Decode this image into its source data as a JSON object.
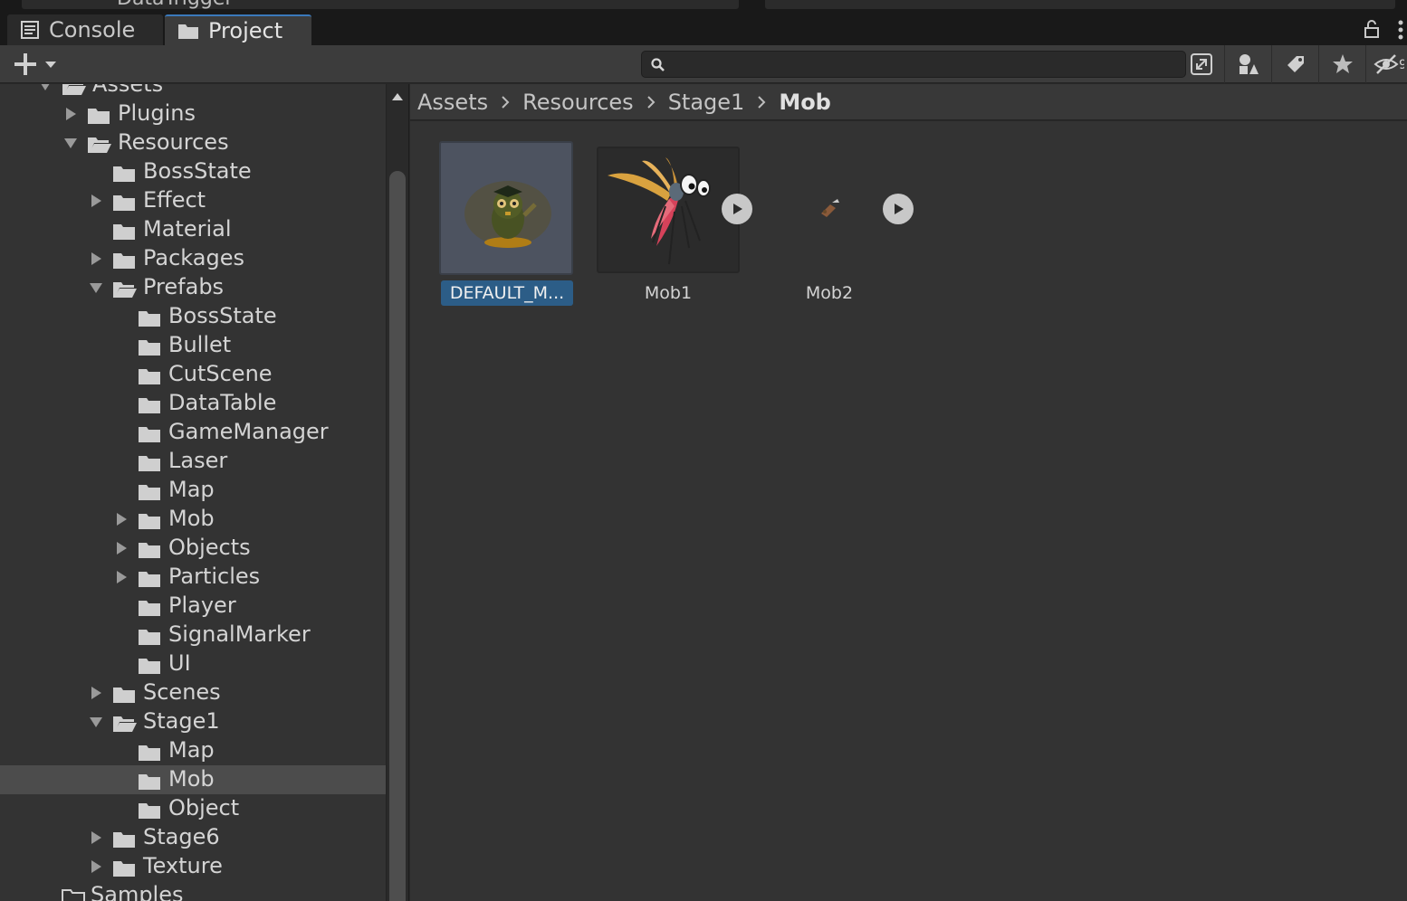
{
  "top_strip": {
    "partial_title": "DataTrigger"
  },
  "tabs": [
    {
      "label": "Console",
      "icon": "console-icon"
    },
    {
      "label": "Project",
      "icon": "folder-icon",
      "active": true
    }
  ],
  "search": {
    "value": "",
    "placeholder": ""
  },
  "toolbar_icons": [
    "create-plus-icon",
    "open-window-icon",
    "filter-by-type-icon",
    "filter-by-label-icon",
    "favorites-star-icon",
    "hidden-packages-icon"
  ],
  "tree": {
    "root_label": "Assets",
    "items": [
      {
        "label": "Plugins",
        "level": 1,
        "arrow": "right",
        "open": false
      },
      {
        "label": "Resources",
        "level": 1,
        "arrow": "down",
        "open": true
      },
      {
        "label": "BossState",
        "level": 2,
        "arrow": "none",
        "open": false
      },
      {
        "label": "Effect",
        "level": 2,
        "arrow": "right",
        "open": false
      },
      {
        "label": "Material",
        "level": 2,
        "arrow": "none",
        "open": false
      },
      {
        "label": "Packages",
        "level": 2,
        "arrow": "right",
        "open": false
      },
      {
        "label": "Prefabs",
        "level": 2,
        "arrow": "down",
        "open": true
      },
      {
        "label": "BossState",
        "level": 3,
        "arrow": "none",
        "open": false
      },
      {
        "label": "Bullet",
        "level": 3,
        "arrow": "none",
        "open": false
      },
      {
        "label": "CutScene",
        "level": 3,
        "arrow": "none",
        "open": false
      },
      {
        "label": "DataTable",
        "level": 3,
        "arrow": "none",
        "open": false
      },
      {
        "label": "GameManager",
        "level": 3,
        "arrow": "none",
        "open": false
      },
      {
        "label": "Laser",
        "level": 3,
        "arrow": "none",
        "open": false
      },
      {
        "label": "Map",
        "level": 3,
        "arrow": "none",
        "open": false
      },
      {
        "label": "Mob",
        "level": 3,
        "arrow": "right",
        "open": false
      },
      {
        "label": "Objects",
        "level": 3,
        "arrow": "right",
        "open": false
      },
      {
        "label": "Particles",
        "level": 3,
        "arrow": "right",
        "open": false
      },
      {
        "label": "Player",
        "level": 3,
        "arrow": "none",
        "open": false
      },
      {
        "label": "SignalMarker",
        "level": 3,
        "arrow": "none",
        "open": false
      },
      {
        "label": "UI",
        "level": 3,
        "arrow": "none",
        "open": false
      },
      {
        "label": "Scenes",
        "level": 2,
        "arrow": "right",
        "open": false
      },
      {
        "label": "Stage1",
        "level": 2,
        "arrow": "down",
        "open": true
      },
      {
        "label": "Map",
        "level": 3,
        "arrow": "none",
        "open": false
      },
      {
        "label": "Mob",
        "level": 3,
        "arrow": "none",
        "open": false,
        "selected": true
      },
      {
        "label": "Object",
        "level": 3,
        "arrow": "none",
        "open": false
      },
      {
        "label": "Stage6",
        "level": 2,
        "arrow": "right",
        "open": false
      },
      {
        "label": "Texture",
        "level": 2,
        "arrow": "right",
        "open": false
      }
    ],
    "partial_bottom_label": "Samples"
  },
  "breadcrumb": [
    "Assets",
    "Resources",
    "Stage1",
    "Mob"
  ],
  "assets": [
    {
      "label": "DEFAULT_M...",
      "type": "material",
      "selected": true
    },
    {
      "label": "Mob1",
      "type": "sprite-animation",
      "has_play": true
    },
    {
      "label": "Mob2",
      "type": "sprite-animation",
      "has_play": true
    }
  ],
  "colors": {
    "selection_blue": "#2c5d87",
    "active_tab_accent": "#3a79bb",
    "selected_row": "#4c4c4c"
  }
}
